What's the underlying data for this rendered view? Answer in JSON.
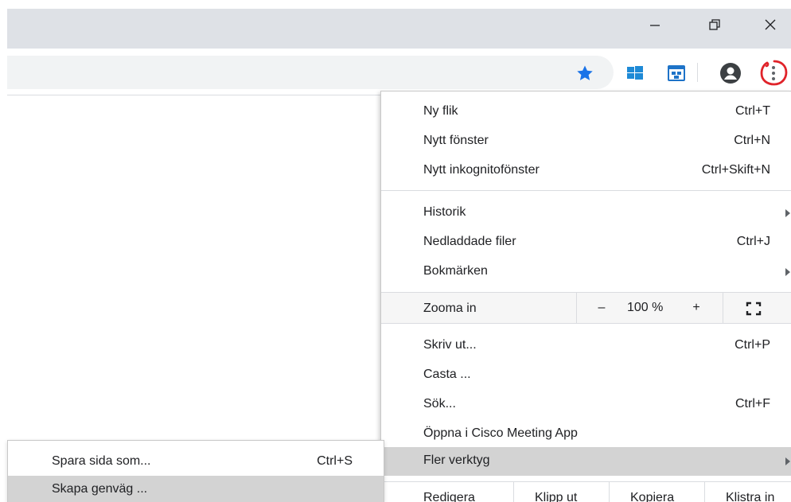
{
  "window": {
    "buttons": [
      "minimize",
      "restore",
      "close"
    ],
    "colors": {
      "titlebar": "#dee1e6",
      "menu_highlight": "#d3d3d3",
      "star": "#1a73e8",
      "annotation": "#e0232a"
    }
  },
  "toolbar": {
    "icons": [
      "star-bookmark-icon",
      "windows-extension-icon",
      "translate-extension-icon",
      "profile-icon",
      "kebab-menu-icon"
    ]
  },
  "menu": {
    "new_tab": {
      "label": "Ny flik",
      "shortcut": "Ctrl+T"
    },
    "new_window": {
      "label": "Nytt fönster",
      "shortcut": "Ctrl+N"
    },
    "incognito": {
      "label": "Nytt inkognitofönster",
      "shortcut": "Ctrl+Skift+N"
    },
    "history": {
      "label": "Historik"
    },
    "downloads": {
      "label": "Nedladdade filer",
      "shortcut": "Ctrl+J"
    },
    "bookmarks": {
      "label": "Bokmärken"
    },
    "zoom": {
      "label": "Zooma in",
      "minus": "–",
      "value": "100 %",
      "plus": "+"
    },
    "print": {
      "label": "Skriv ut...",
      "shortcut": "Ctrl+P"
    },
    "cast": {
      "label": "Casta ..."
    },
    "find": {
      "label": "Sök...",
      "shortcut": "Ctrl+F"
    },
    "cisco": {
      "label": "Öppna i Cisco Meeting App"
    },
    "more_tools": {
      "label": "Fler verktyg"
    },
    "edit": {
      "label": "Redigera",
      "cut": "Klipp ut",
      "copy": "Kopiera",
      "paste": "Klistra in"
    }
  },
  "submenu": {
    "save_page": {
      "label": "Spara sida som...",
      "shortcut": "Ctrl+S"
    },
    "create_shortcut": {
      "label": "Skapa genväg ..."
    }
  }
}
